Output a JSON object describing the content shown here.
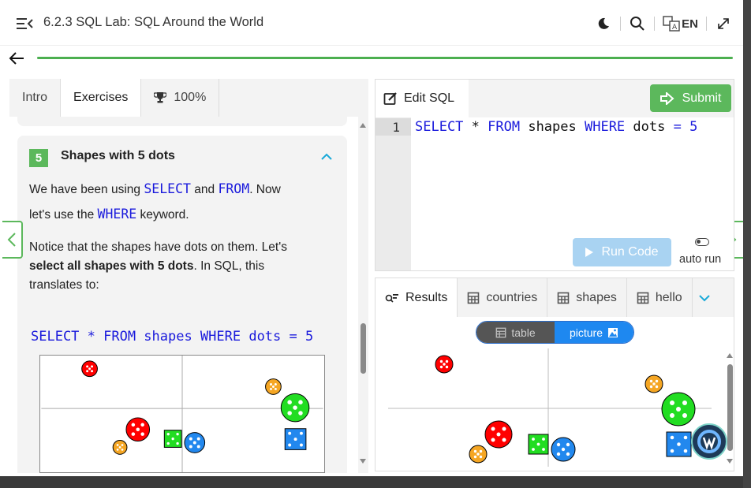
{
  "header": {
    "title": "6.2.3 SQL Lab: SQL Around the World",
    "language": "EN"
  },
  "progress": {
    "fraction": 1.0,
    "color": "#4caf50"
  },
  "left_tabs": [
    {
      "label": "Intro",
      "active": false
    },
    {
      "label": "Exercises",
      "active": true
    },
    {
      "label": "100%",
      "icon": "trophy-icon",
      "active": false
    }
  ],
  "exercise": {
    "number": "5",
    "title": "Shapes with 5 dots",
    "p1_a": "We have been using ",
    "p1_kw1": "SELECT",
    "p1_b": " and ",
    "p1_kw2": "FROM",
    "p1_c": ". Now",
    "p1_d": "let's use the ",
    "p1_kw3": "WHERE",
    "p1_e": " keyword.",
    "p2_a": "Notice that the shapes have dots on them. Let's",
    "p2_bold": "select all shapes with 5 dots",
    "p2_b": ". In SQL, this",
    "p2_c": "translates to:",
    "code": "SELECT * FROM shapes WHERE dots = 5"
  },
  "editor": {
    "tab_label": "Edit SQL",
    "submit_label": "Submit",
    "line_number": "1",
    "code_kw_select": "SELECT",
    "code_star": " * ",
    "code_kw_from": "FROM",
    "code_table": " shapes ",
    "code_kw_where": "WHERE",
    "code_rest": " dots ",
    "code_eq": "=",
    "code_val": " 5",
    "run_label": "Run Code",
    "autorun_label": "auto run"
  },
  "results": {
    "tabs": [
      {
        "label": "Results",
        "icon": "results-icon",
        "active": true
      },
      {
        "label": "countries",
        "icon": "table-icon",
        "active": false
      },
      {
        "label": "shapes",
        "icon": "table-icon",
        "active": false
      },
      {
        "label": "hello",
        "icon": "table-icon",
        "active": false
      }
    ],
    "view_table": "table",
    "view_picture": "picture"
  },
  "shapes_colors": {
    "red": "#ff0000",
    "orange": "#f5a623",
    "green": "#22dd22",
    "blue": "#2288ee"
  }
}
